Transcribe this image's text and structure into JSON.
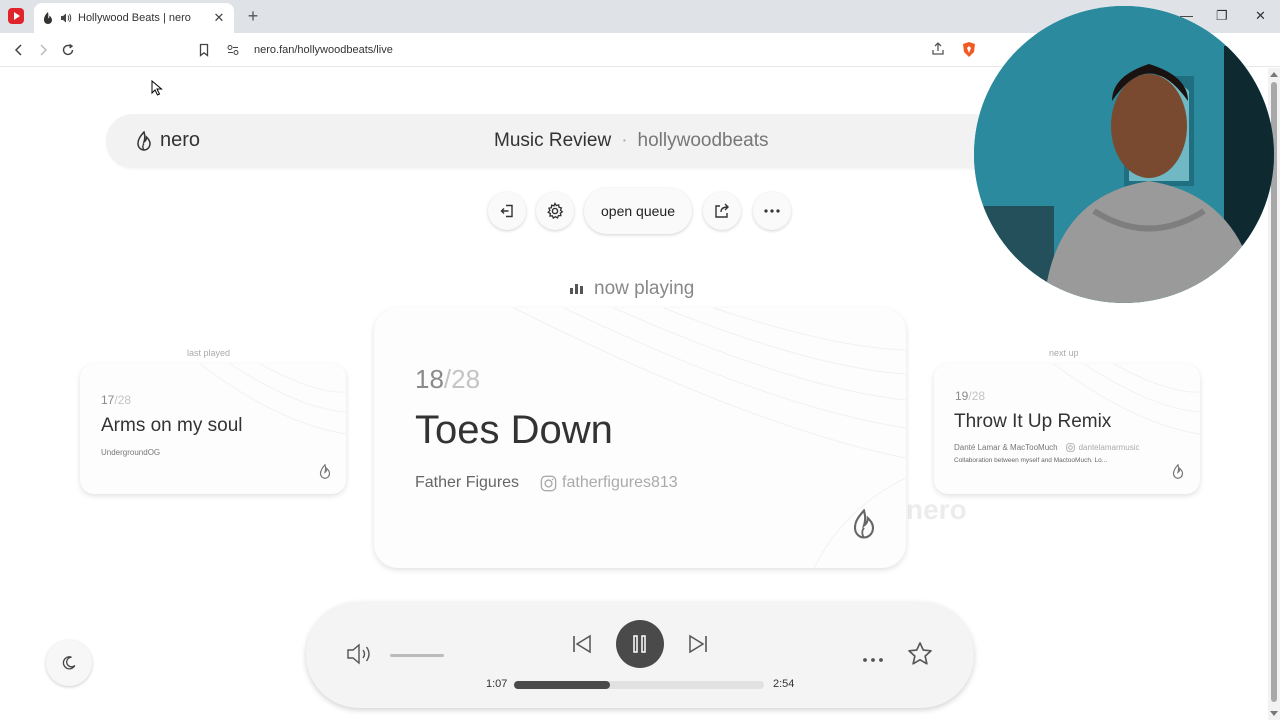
{
  "browser": {
    "tab_title": "Hollywood Beats | nero",
    "tab_close": "✕",
    "new_tab": "+",
    "url": "nero.fan/hollywoodbeats/live",
    "window_controls": [
      "—",
      "❐",
      "✕"
    ]
  },
  "header": {
    "brand": "nero",
    "title": "Music Review",
    "separator": "·",
    "channel": "hollywoodbeats"
  },
  "controls": {
    "exit_icon": "exit-icon",
    "settings_icon": "gear-icon",
    "open_queue": "open queue",
    "share_icon": "share-icon",
    "more_icon": "more-icon"
  },
  "now_playing": {
    "label": "now playing",
    "track_number": "18",
    "track_total": "/28",
    "song": "Toes Down",
    "artist": "Father Figures",
    "instagram": "fatherfigures813"
  },
  "last_played": {
    "label": "last played",
    "track_number": "17",
    "track_total": "/28",
    "song": "Arms on my soul",
    "artist": "UndergroundOG"
  },
  "next_up": {
    "label": "next up",
    "track_number": "19",
    "track_total": "/28",
    "song": "Throw It Up Remix",
    "artist": "Danté Lamar & MacTooMuch",
    "instagram": "dantelamarmusic",
    "description": "Collaboration between myself and MactooMuch. Lo..."
  },
  "watermark": "nero",
  "player": {
    "elapsed": "1:07",
    "duration": "2:54",
    "progress": 0.385,
    "volume": 0.0
  },
  "colors": {
    "accent_dark": "#4a4a4a",
    "page_bg": "#ffffff",
    "card_bg": "#fdfdfd"
  }
}
